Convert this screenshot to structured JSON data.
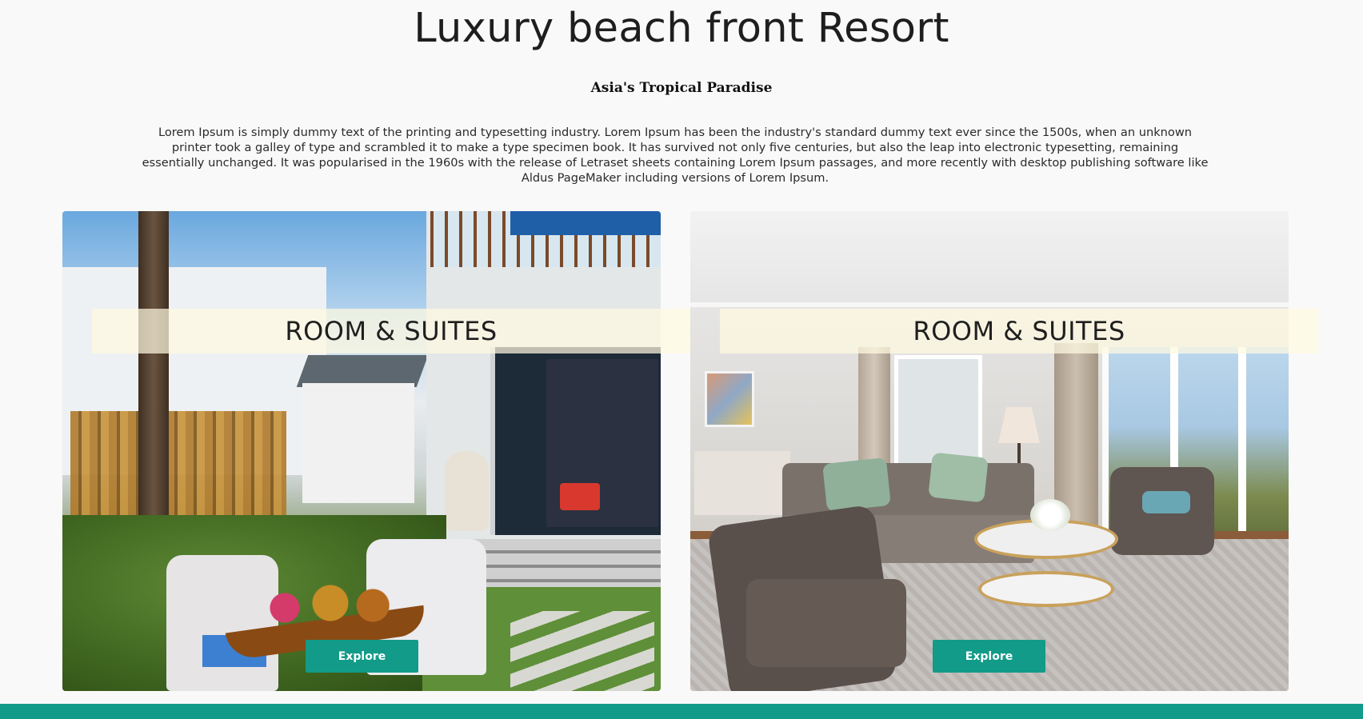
{
  "header": {
    "title": "Luxury beach front Resort",
    "subtitle": "Asia's Tropical Paradise",
    "intro": "Lorem Ipsum is simply dummy text of the printing and typesetting industry. Lorem Ipsum has been the industry's standard dummy text ever since the 1500s, when an unknown printer took a galley of type and scrambled it to make a type specimen book. It has survived not only five centuries, but also the leap into electronic typesetting, remaining essentially unchanged. It was popularised in the 1960s with the release of Letraset sheets containing Lorem Ipsum passages, and more recently with desktop publishing software like Aldus PageMaker including versions of Lorem Ipsum."
  },
  "cards": [
    {
      "title": "ROOM & SUITES",
      "button_label": "Explore",
      "image": "garden-villa-photo"
    },
    {
      "title": "ROOM & SUITES",
      "button_label": "Explore",
      "image": "living-room-photo"
    }
  ],
  "colors": {
    "accent": "#129b88",
    "banner": "#fffae1",
    "background": "#f9f9f9"
  }
}
